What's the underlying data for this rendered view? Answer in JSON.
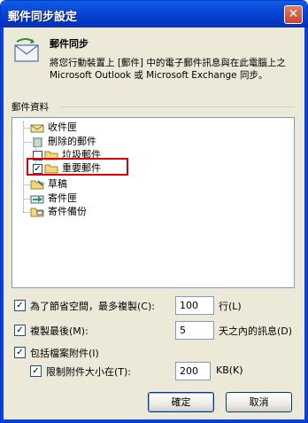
{
  "window": {
    "title": "郵件同步設定",
    "close_glyph": "✕"
  },
  "header": {
    "heading": "郵件同步",
    "description": "將您行動裝置上 [郵件] 中的電子郵件訊息與在此電腦上之  Microsoft Outlook 或 Microsoft Exchange 同步。",
    "icon": "envelope-sync-icon"
  },
  "group": {
    "label": "郵件資料"
  },
  "tree": [
    {
      "label": "收件匣",
      "checked": null,
      "icon": "inbox-icon"
    },
    {
      "label": "刪除的郵件",
      "checked": null,
      "icon": "trash-icon"
    },
    {
      "label": "垃圾郵件",
      "checked": false,
      "icon": "folder-icon"
    },
    {
      "label": "重要郵件",
      "checked": true,
      "icon": "folder-icon"
    },
    {
      "label": "草稿",
      "checked": null,
      "icon": "drafts-icon"
    },
    {
      "label": "寄件匣",
      "checked": null,
      "icon": "outbox-icon"
    },
    {
      "label": "寄件備份",
      "checked": null,
      "icon": "sent-icon"
    }
  ],
  "options": {
    "save_space": {
      "label": "為了節省空間，最多複製(C):",
      "value": "100",
      "unit": "行(L)",
      "checked": true
    },
    "copy_last": {
      "label": "複製最後(M):",
      "value": "5",
      "unit": "天之內的訊息(D)",
      "checked": true
    },
    "include_attachments": {
      "label": "包括檔案附件(I)",
      "checked": true
    },
    "limit_attachment": {
      "label": "限制附件大小在(T):",
      "value": "200",
      "unit": "KB(K)",
      "checked": true
    }
  },
  "buttons": {
    "ok": "確定",
    "cancel": "取消"
  },
  "colors": {
    "titlebar": "#0a46d8",
    "highlight_border": "#e00000",
    "dialog_bg": "#ece9d8"
  }
}
